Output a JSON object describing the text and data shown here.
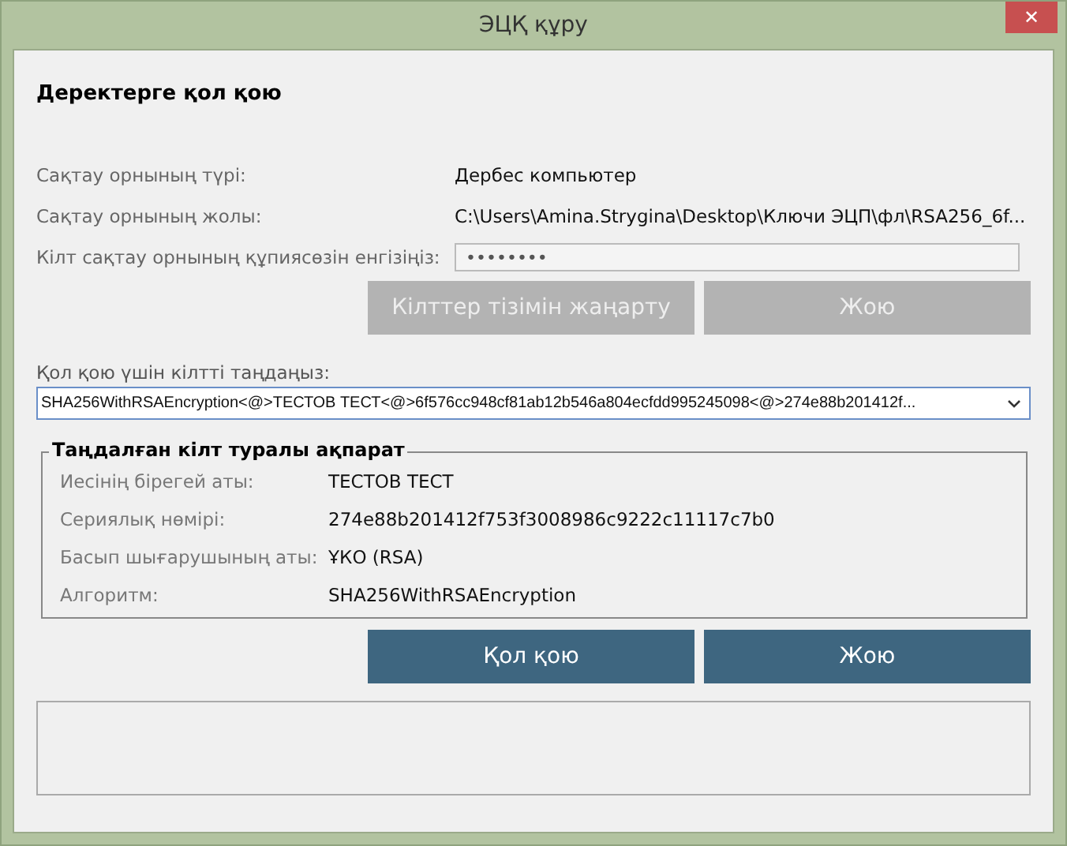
{
  "window": {
    "title": "ЭЦҚ құру",
    "close": "✕"
  },
  "heading": "Деректерге қол қою",
  "storage_fields": [
    {
      "kind": "text",
      "label": "Сақтау орнының түрі:",
      "value": "Дербес компьютер"
    },
    {
      "kind": "text",
      "label": "Сақтау орнының жолы:",
      "value": "C:\\Users\\Amina.Strygina\\Desktop\\Ключи ЭЦП\\фл\\RSA256_6f..."
    },
    {
      "kind": "password",
      "label": "Кілт сақтау орнының құпиясөзін енгізіңіз:",
      "value": "••••••••"
    }
  ],
  "storage_buttons": [
    {
      "label": "Кілттер тізімін жаңарту",
      "disabled": true
    },
    {
      "label": "Жою",
      "disabled": true
    }
  ],
  "key_select": {
    "label": "Қол қою үшін кілтті таңдаңыз:",
    "value": "SHA256WithRSAEncryption<@>ТЕСТОВ ТЕСТ<@>6f576cc948cf81ab12b546a804ecfdd995245098<@>274e88b201412f..."
  },
  "key_info": {
    "title": "Таңдалған кілт туралы ақпарат",
    "rows": [
      {
        "label": "Иесінің бірегей аты:",
        "value": "ТЕСТОВ ТЕСТ"
      },
      {
        "label": "Сериялық нөмірі:",
        "value": "274e88b201412f753f3008986c9222c11117c7b0"
      },
      {
        "label": "Басып шығарушының аты:",
        "value": "ҰКО (RSA)"
      },
      {
        "label": "Алгоритм:",
        "value": "SHA256WithRSAEncryption"
      }
    ]
  },
  "action_buttons": [
    {
      "label": "Қол қою",
      "disabled": false
    },
    {
      "label": "Жою",
      "disabled": false
    }
  ]
}
